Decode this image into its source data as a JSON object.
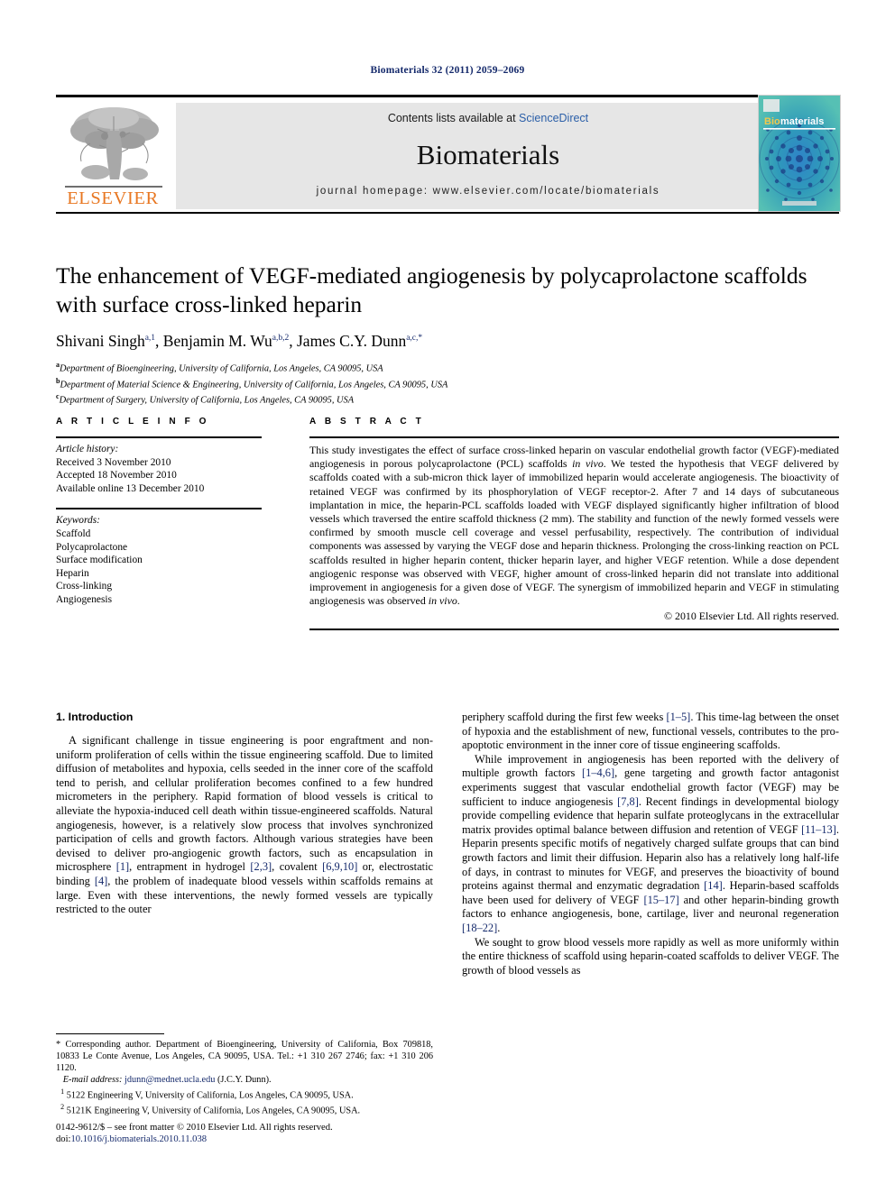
{
  "running_head": "Biomaterials 32 (2011) 2059–2069",
  "masthead": {
    "publisher_name": "ELSEVIER",
    "contents_prefix": "Contents lists available at ",
    "contents_link": "ScienceDirect",
    "journal_name": "Biomaterials",
    "homepage": "journal homepage: www.elsevier.com/locate/biomaterials",
    "cover_title": "Biomaterials",
    "cover_logo_text": "ELSEVIER"
  },
  "title": "The enhancement of VEGF-mediated angiogenesis by polycaprolactone scaffolds with surface cross-linked heparin",
  "authors": [
    {
      "name": "Shivani Singh",
      "marks": "a,1",
      "sep": ", "
    },
    {
      "name": "Benjamin M. Wu",
      "marks": "a,b,2",
      "sep": ", "
    },
    {
      "name": "James C.Y. Dunn",
      "marks": "a,c,*",
      "sep": ""
    }
  ],
  "affiliations": [
    {
      "mark": "a",
      "text": "Department of Bioengineering, University of California, Los Angeles, CA 90095, USA"
    },
    {
      "mark": "b",
      "text": "Department of Material Science & Engineering, University of California, Los Angeles, CA 90095, USA"
    },
    {
      "mark": "c",
      "text": "Department of Surgery, University of California, Los Angeles, CA 90095, USA"
    }
  ],
  "section_headers": {
    "article_info": "A R T I C L E  I N F O",
    "abstract": "A B S T R A C T"
  },
  "article_history": {
    "label": "Article history:",
    "lines": [
      "Received 3 November 2010",
      "Accepted 18 November 2010",
      "Available online 13 December 2010"
    ]
  },
  "keywords": {
    "label": "Keywords:",
    "items": [
      "Scaffold",
      "Polycaprolactone",
      "Surface modification",
      "Heparin",
      "Cross-linking",
      "Angiogenesis"
    ]
  },
  "abstract": {
    "part1": "This study investigates the effect of surface cross-linked heparin on vascular endothelial growth factor (VEGF)-mediated angiogenesis in porous polycaprolactone (PCL) scaffolds ",
    "italic1": "in vivo",
    "part2": ". We tested the hypothesis that VEGF delivered by scaffolds coated with a sub-micron thick layer of immobilized heparin would accelerate angiogenesis. The bioactivity of retained VEGF was confirmed by its phosphorylation of VEGF receptor-2. After 7 and 14 days of subcutaneous implantation in mice, the heparin-PCL scaffolds loaded with VEGF displayed significantly higher infiltration of blood vessels which traversed the entire scaffold thickness (2 mm). The stability and function of the newly formed vessels were confirmed by smooth muscle cell coverage and vessel perfusability, respectively. The contribution of individual components was assessed by varying the VEGF dose and heparin thickness. Prolonging the cross-linking reaction on PCL scaffolds resulted in higher heparin content, thicker heparin layer, and higher VEGF retention. While a dose dependent angiogenic response was observed with VEGF, higher amount of cross-linked heparin did not translate into additional improvement in angiogenesis for a given dose of VEGF. The synergism of immobilized heparin and VEGF in stimulating angiogenesis was observed ",
    "italic2": "in vivo",
    "part3": ".",
    "copyright": "© 2010 Elsevier Ltd. All rights reserved."
  },
  "introduction": {
    "heading": "1.  Introduction",
    "left_paragraph_1_a": "A significant challenge in tissue engineering is poor engraftment and non-uniform proliferation of cells within the tissue engineering scaffold. Due to limited diffusion of metabolites and hypoxia, cells seeded in the inner core of the scaffold tend to perish, and cellular proliferation becomes confined to a few hundred micrometers in the periphery. Rapid formation of blood vessels is critical to alleviate the hypoxia-induced cell death within tissue-engineered scaffolds. Natural angiogenesis, however, is a relatively slow process that involves synchronized participation of cells and growth factors. Although various strategies have been devised to deliver pro-angiogenic growth factors, such as encapsulation in microsphere ",
    "ref_1": "[1]",
    "left_paragraph_1_b": ", entrapment in hydrogel ",
    "ref_23": "[2,3]",
    "left_paragraph_1_c": ", covalent ",
    "ref_6910": "[6,9,10]",
    "left_paragraph_1_d": " or, electrostatic binding ",
    "ref_4": "[4]",
    "left_paragraph_1_e": ", the problem of inadequate blood vessels within scaffolds remains at large. Even with these interventions, the newly formed vessels are typically restricted to the outer",
    "right_paragraph_1_a": "periphery scaffold during the first few weeks ",
    "ref_15": "[1–5]",
    "right_paragraph_1_b": ". This time-lag between the onset of hypoxia and the establishment of new, functional vessels, contributes to the pro-apoptotic environment in the inner core of tissue engineering scaffolds.",
    "right_paragraph_2_a": "While improvement in angiogenesis has been reported with the delivery of multiple growth factors ",
    "ref_146": "[1–4,6]",
    "right_paragraph_2_b": ", gene targeting and growth factor antagonist experiments suggest that vascular endothelial growth factor (VEGF) may be sufficient to induce angiogenesis ",
    "ref_78": "[7,8]",
    "right_paragraph_2_c": ". Recent findings in developmental biology provide compelling evidence that heparin sulfate proteoglycans in the extracellular matrix provides optimal balance between diffusion and retention of VEGF ",
    "ref_1113": "[11–13]",
    "right_paragraph_2_d": ". Heparin presents specific motifs of negatively charged sulfate groups that can bind growth factors and limit their diffusion. Heparin also has a relatively long half-life of days, in contrast to minutes for VEGF, and preserves the bioactivity of bound proteins against thermal and enzymatic degradation ",
    "ref_14": "[14]",
    "right_paragraph_2_e": ". Heparin-based scaffolds have been used for delivery of VEGF ",
    "ref_1517": "[15–17]",
    "right_paragraph_2_f": " and other heparin-binding growth factors to enhance angiogenesis, bone, cartilage, liver and neuronal regeneration ",
    "ref_1822": "[18–22]",
    "right_paragraph_2_g": ".",
    "right_paragraph_3": "We sought to grow blood vessels more rapidly as well as more uniformly within the entire thickness of scaffold using heparin-coated scaffolds to deliver VEGF. The growth of blood vessels as"
  },
  "footnotes": {
    "corresponding": "*  Corresponding author. Department of Bioengineering, University of California, Box 709818, 10833 Le Conte Avenue, Los Angeles, CA 90095, USA. Tel.: +1 310 267 2746; fax: +1 310 206 1120.",
    "email_label": "E-mail address:",
    "email_link": "jdunn@mednet.ucla.edu",
    "email_suffix": " (J.C.Y. Dunn).",
    "note1_mark": "1",
    "note1": "5122 Engineering V, University of California, Los Angeles, CA 90095, USA.",
    "note2_mark": "2",
    "note2": "5121K Engineering V, University of California, Los Angeles, CA 90095, USA."
  },
  "imprint": {
    "issn_line": "0142-9612/$ – see front matter © 2010 Elsevier Ltd. All rights reserved.",
    "doi_label": "doi:",
    "doi_value": "10.1016/j.biomaterials.2010.11.038"
  },
  "colors": {
    "elsevier_orange": "#e87722",
    "link_blue": "#2b5fa8",
    "ref_blue": "#14296b",
    "band_gray": "#e6e6e6",
    "cover_teal": "#3aa8a5"
  }
}
